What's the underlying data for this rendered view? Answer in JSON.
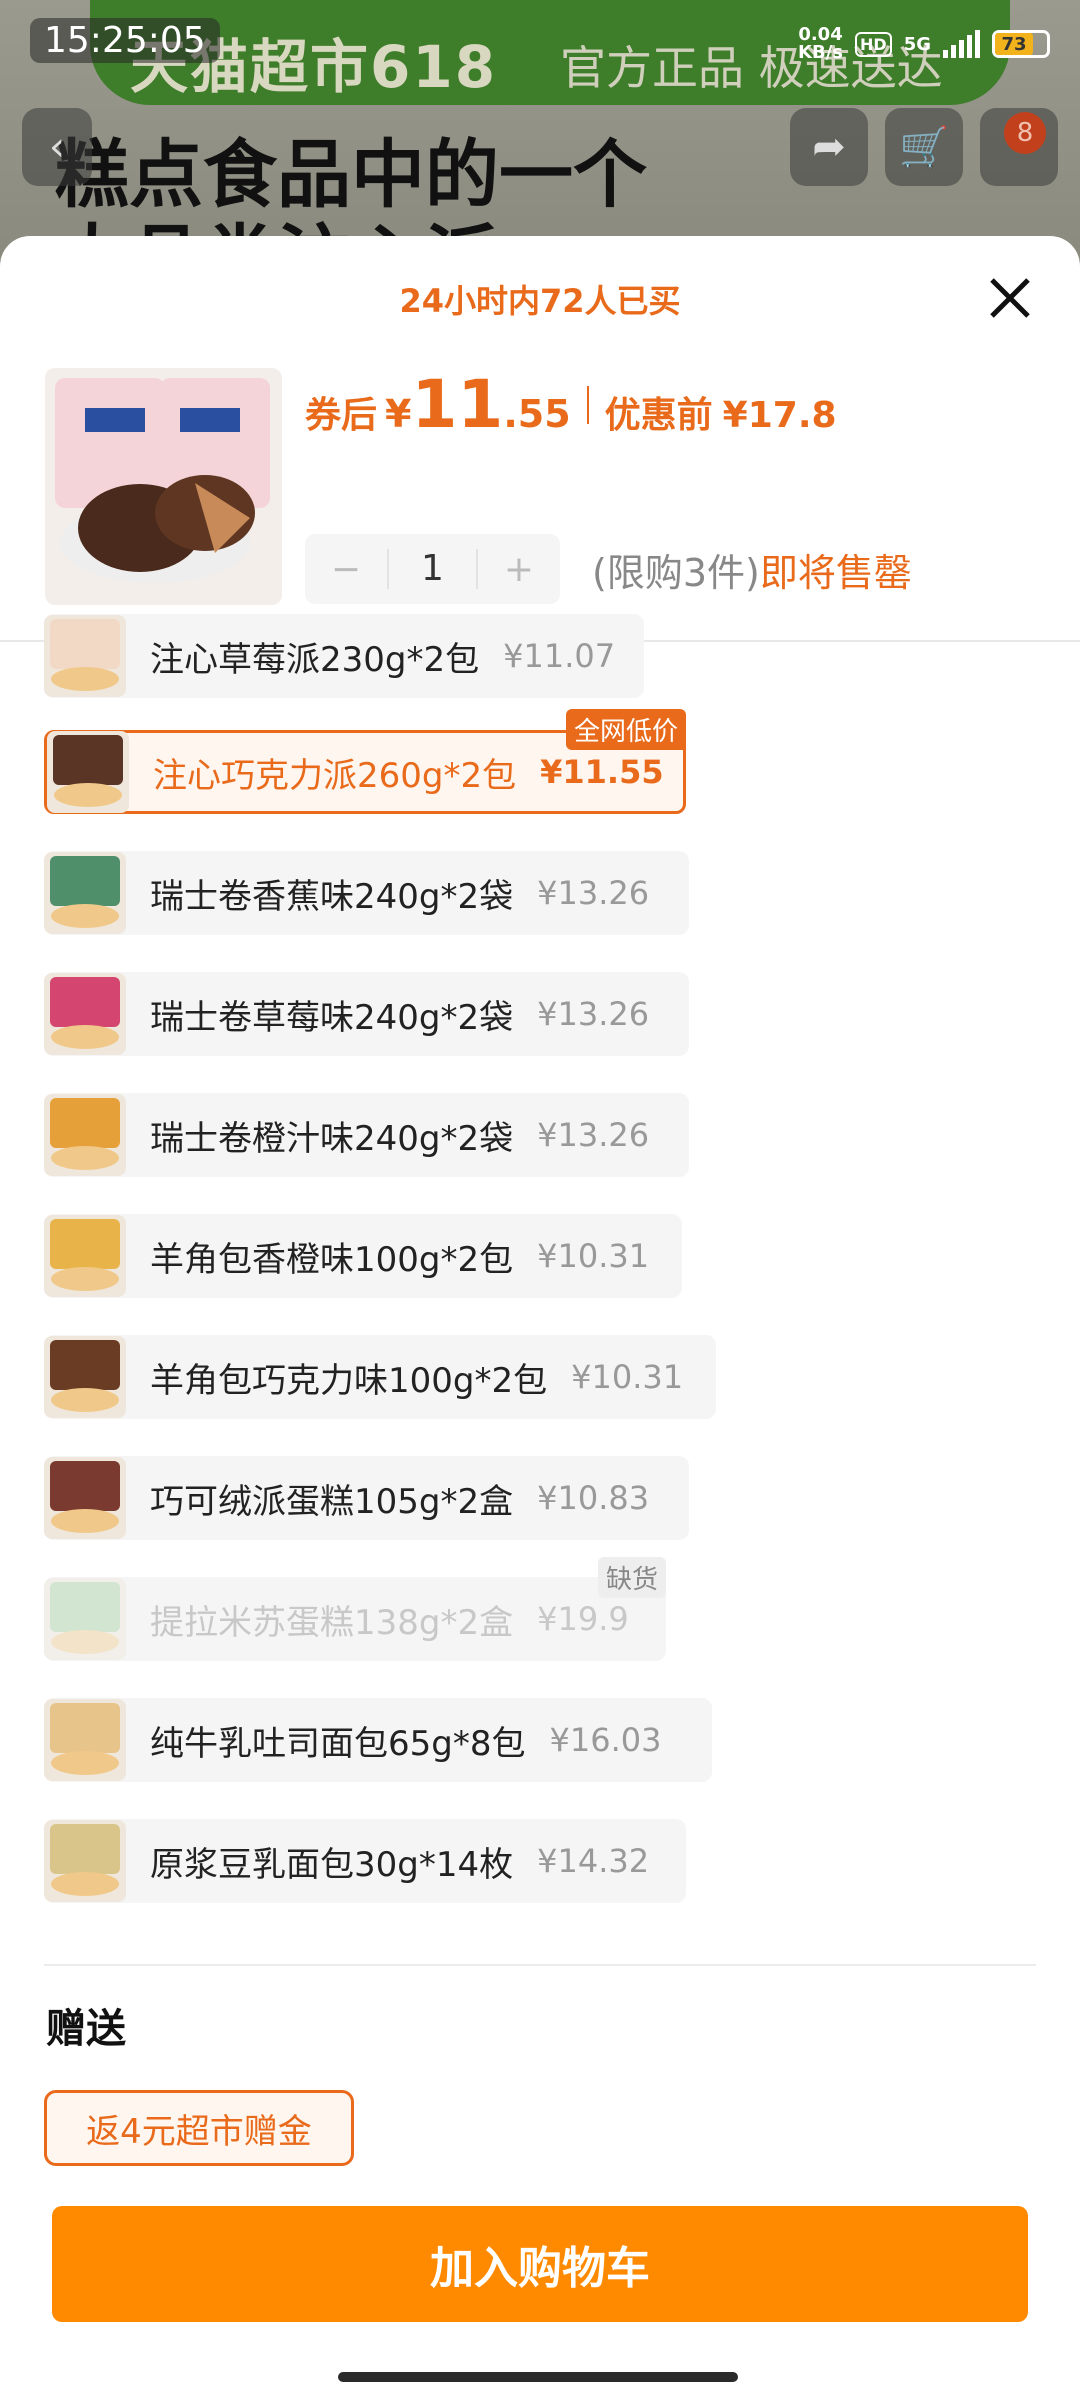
{
  "status_bar": {
    "time": "15:25:05",
    "net_speed_value": "0.04",
    "net_speed_unit": "KB/s",
    "hd": "HD",
    "network": "5G",
    "battery": "73"
  },
  "background_page": {
    "banner_text": "天猫超市618",
    "banner_sub": "官方正品 极速送达",
    "title_line1": "糕点食品中的一个",
    "title_line2": "大品类注心派",
    "cart_badge": "8"
  },
  "sheet": {
    "sold_text": "24小时内72人已买",
    "price": {
      "after_label": "券后",
      "yen": "¥",
      "after_int": "11",
      "after_dec": ".55",
      "before_label": "优惠前",
      "before_value": "¥17.8"
    },
    "stepper": {
      "minus": "−",
      "value": "1",
      "plus": "+"
    },
    "limit_gray": "(限购3件)",
    "limit_orange": "即将售罄",
    "options": [
      {
        "name": "注心草莓派230g*2包",
        "price": "¥11.07",
        "state": "normal",
        "thumb_color": "#f2d9c6"
      },
      {
        "name": "注心巧克力派260g*2包",
        "price": "¥11.55",
        "state": "selected",
        "tag": "全网低价",
        "thumb_color": "#5a3424"
      },
      {
        "name": "瑞士卷香蕉味240g*2袋",
        "price": "¥13.26",
        "state": "normal",
        "thumb_color": "#4f8f6a"
      },
      {
        "name": "瑞士卷草莓味240g*2袋",
        "price": "¥13.26",
        "state": "normal",
        "thumb_color": "#d4466f"
      },
      {
        "name": "瑞士卷橙汁味240g*2袋",
        "price": "¥13.26",
        "state": "normal",
        "thumb_color": "#e6a03a"
      },
      {
        "name": "羊角包香橙味100g*2包",
        "price": "¥10.31",
        "state": "normal",
        "thumb_color": "#e8b44a"
      },
      {
        "name": "羊角包巧克力味100g*2包",
        "price": "¥10.31",
        "state": "normal",
        "thumb_color": "#6b3c24"
      },
      {
        "name": "巧可绒派蛋糕105g*2盒",
        "price": "¥10.83",
        "state": "normal",
        "thumb_color": "#7a3a30"
      },
      {
        "name": "提拉米苏蛋糕138g*2盒",
        "price": "¥19.9",
        "state": "disabled",
        "tag": "缺货",
        "thumb_color": "#9ccf9a"
      },
      {
        "name": "纯牛乳吐司面包65g*8包",
        "price": "¥16.03",
        "state": "normal",
        "thumb_color": "#e7c48a"
      },
      {
        "name": "原浆豆乳面包30g*14枚",
        "price": "¥14.32",
        "state": "normal",
        "thumb_color": "#d9c48a"
      }
    ],
    "gift_title": "赠送",
    "gift_chip": "返4元超市赠金",
    "add_to_cart": "加入购物车"
  },
  "colors": {
    "accent": "#e86a1a",
    "cta": "#ff8a00"
  }
}
